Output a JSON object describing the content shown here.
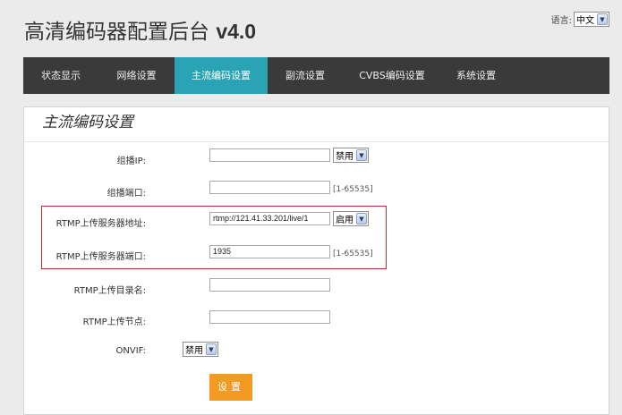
{
  "header": {
    "title_cn": "高清编码器配置后台",
    "title_ver": "v4.0",
    "lang_label": "语言:",
    "lang_value": "中文"
  },
  "nav": {
    "items": [
      {
        "label": "状态显示"
      },
      {
        "label": "网络设置"
      },
      {
        "label": "主流编码设置"
      },
      {
        "label": "副流设置"
      },
      {
        "label": "CVBS编码设置"
      },
      {
        "label": "系统设置"
      }
    ]
  },
  "panel": {
    "title": "主流编码设置"
  },
  "form": {
    "multicast_ip": {
      "label": "组播IP:",
      "value": "",
      "select": "禁用"
    },
    "multicast_port": {
      "label": "组播端口:",
      "value": "",
      "hint": "[1-65535]"
    },
    "rtmp_addr": {
      "label": "RTMP上传服务器地址:",
      "value": "rtmp://121.41.33.201/live/1",
      "select": "启用"
    },
    "rtmp_port": {
      "label": "RTMP上传服务器端口:",
      "value": "1935",
      "hint": "[1-65535]"
    },
    "rtmp_dir": {
      "label": "RTMP上传目录名:",
      "value": ""
    },
    "rtmp_node": {
      "label": "RTMP上传节点:",
      "value": ""
    },
    "onvif": {
      "label": "ONVIF:",
      "select": "禁用"
    },
    "submit_label": "设置"
  }
}
